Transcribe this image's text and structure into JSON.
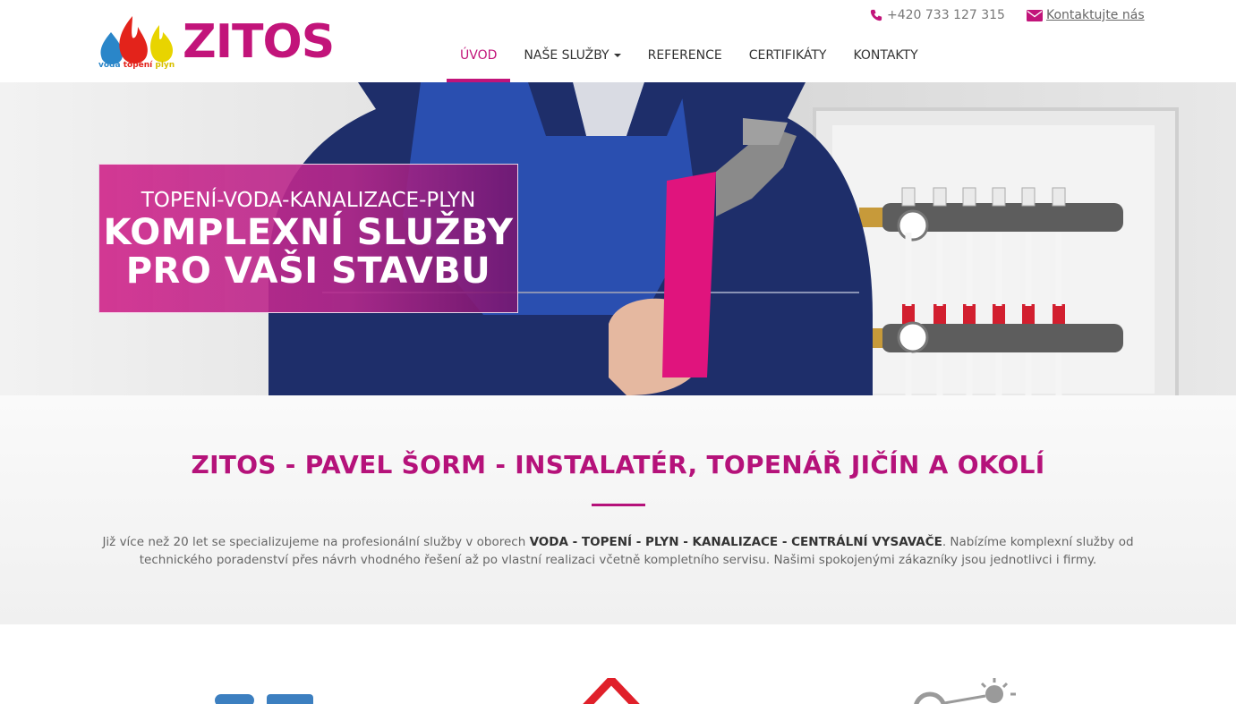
{
  "brand": {
    "name": "ZITOS",
    "tag_water": "voda",
    "tag_heating": "topení",
    "tag_gas": "plyn"
  },
  "topbar": {
    "phone": "+420 733 127 315",
    "contact_link": "Kontaktujte nás"
  },
  "nav": {
    "items": [
      {
        "label": "ÚVOD",
        "active": true
      },
      {
        "label": "NAŠE SLUŽBY",
        "dropdown": true
      },
      {
        "label": "REFERENCE"
      },
      {
        "label": "CERTIFIKÁTY"
      },
      {
        "label": "KONTAKTY"
      }
    ]
  },
  "hero": {
    "subtitle": "TOPENÍ-VODA-KANALIZACE-PLYN",
    "title_line1": "KOMPLEXNÍ SLUŽBY",
    "title_line2": "PRO VAŠI STAVBU"
  },
  "intro": {
    "title": "ZITOS - PAVEL ŠORM - INSTALATÉR, TOPENÁŘ JIČÍN A OKOLÍ",
    "text_before": "Již více než 20 let se specializujeme na profesionální služby v oborech ",
    "text_bold": "VODA - TOPENÍ - PLYN - KANALIZACE - CENTRÁLNÍ VYSAVAČE",
    "text_after": ". Nabízíme komplexní služby od technického poradenství přes návrh vhodného řešení až po vlastní realizaci včetně kompletního servisu. Našimi spokojenými zákazníky jsou jednotlivci i firmy."
  },
  "colors": {
    "accent": "#c2147a",
    "water_blue": "#2a86c9",
    "flame_red": "#e3231b",
    "gas_yellow": "#d8c000"
  }
}
